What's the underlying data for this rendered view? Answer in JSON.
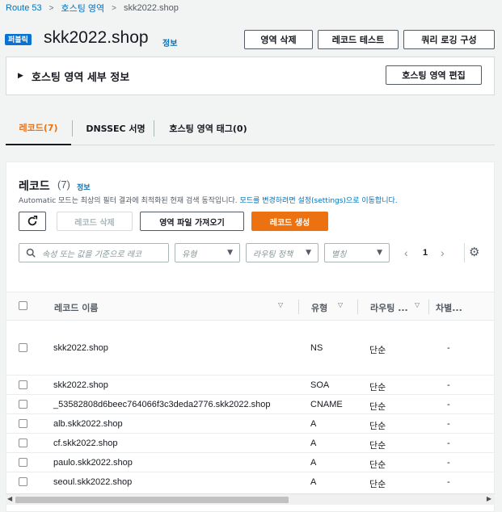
{
  "breadcrumb": [
    "Route 53",
    "호스팅 영역",
    "skk2022.shop"
  ],
  "header": {
    "badge": "퍼블릭",
    "title": "skk2022.shop",
    "info": "정보",
    "buttons": [
      "영역 삭제",
      "레코드 테스트",
      "쿼리 로깅 구성"
    ]
  },
  "details": {
    "title": "호스팅 영역 세부 정보",
    "edit_button": "호스팅 영역 편집"
  },
  "tabs": [
    "레코드(7)",
    "DNSSEC 서명",
    "호스팅 영역 태그(0)"
  ],
  "records": {
    "title": "레코드",
    "count": "(7)",
    "info": "정보",
    "desc_prefix": "Automatic 모드는 최상의 필터 결과에 최적화된 현재 검색 동작입니다. ",
    "desc_link": "모드를 변경하려면 설정(settings)으로 이동합니다.",
    "toolbar": {
      "delete": "레코드 삭제",
      "import": "영역 파일 가져오기",
      "create": "레코드 생성"
    },
    "search_placeholder": "속성 또는 값을 기준으로 레코",
    "filters": [
      "유형",
      "라우팅 정책",
      "별칭"
    ],
    "page": "1",
    "columns": [
      "레코드 이름",
      "유형",
      "라우팅 ...",
      "차별..."
    ],
    "rows": [
      {
        "name": "skk2022.shop",
        "type": "NS",
        "routing": "단순",
        "diff": "-"
      },
      {
        "name": "skk2022.shop",
        "type": "SOA",
        "routing": "단순",
        "diff": "-"
      },
      {
        "name": "_53582808d6beec764066f3c3deda2776.skk2022.shop",
        "type": "CNAME",
        "routing": "단순",
        "diff": "-"
      },
      {
        "name": "alb.skk2022.shop",
        "type": "A",
        "routing": "단순",
        "diff": "-"
      },
      {
        "name": "cf.skk2022.shop",
        "type": "A",
        "routing": "단순",
        "diff": "-"
      },
      {
        "name": "paulo.skk2022.shop",
        "type": "A",
        "routing": "단순",
        "diff": "-"
      },
      {
        "name": "seoul.skk2022.shop",
        "type": "A",
        "routing": "단순",
        "diff": "-"
      }
    ]
  },
  "icons": {
    "refresh": "refresh-icon",
    "search": "search-icon",
    "settings": "gear-icon"
  },
  "colors": {
    "accent": "#ec7211",
    "link": "#0073bb",
    "badge": "#0972d3"
  }
}
